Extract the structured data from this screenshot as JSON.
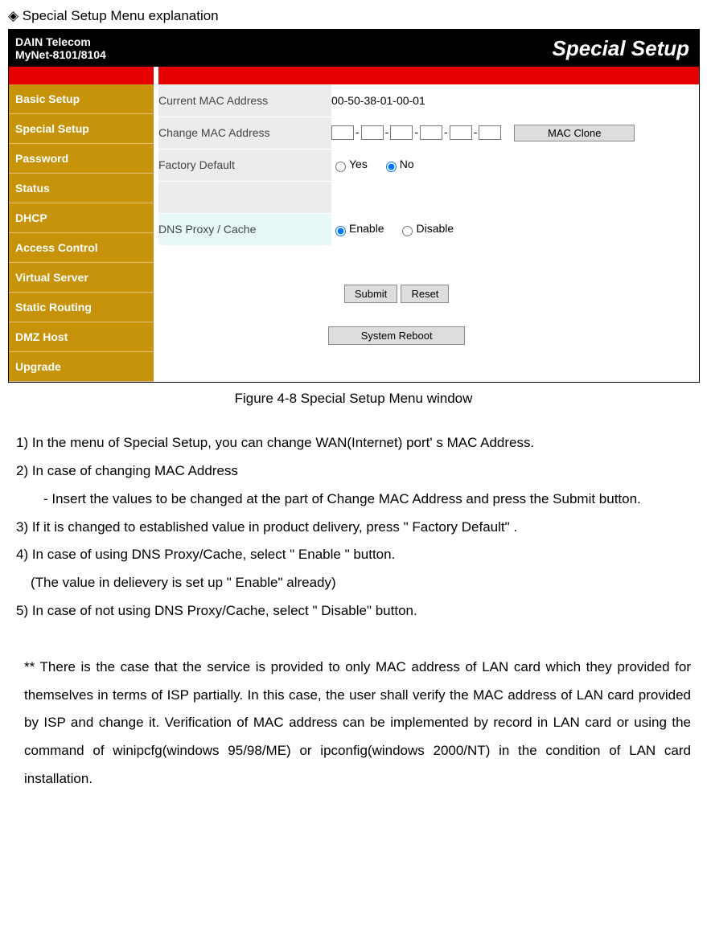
{
  "doc": {
    "heading": "◈  Special Setup Menu explanation",
    "caption": "Figure 4-8    Special Setup Menu window",
    "body": {
      "l1": "1) In the menu of Special Setup, you can change WAN(Internet) port' s MAC Address.",
      "l2": "2) In case of changing MAC Address",
      "l3": "- Insert the values to be changed at the part of Change MAC Address and press the Submit button.",
      "l4": "3) If it is changed to established value in product delivery, press \" Factory Default\" .",
      "l5": "4) In case of using DNS Proxy/Cache, select \" Enable \" button.",
      "l6": "(The value in delievery is set up \" Enable\" already)",
      "l7": "5) In case of not using DNS Proxy/Cache, select \" Disable\" button.",
      "note": "** There is the case that the service is provided to only MAC address of LAN card which they provided for themselves in terms of ISP partially. In this case, the user shall verify the MAC address of LAN card provided by ISP and change it.  Verification of MAC address can be implemented by record in LAN card or using the command of winipcfg(windows 95/98/ME) or ipconfig(windows 2000/NT) in the condition of LAN card installation."
    }
  },
  "ui": {
    "brand_line1": "DAIN Telecom",
    "brand_line2": "MyNet-8101/8104",
    "page_title": "Special Setup",
    "sidebar": [
      "Basic Setup",
      "Special Setup",
      "Password",
      "Status",
      "DHCP",
      "Access Control",
      "Virtual Server",
      "Static Routing",
      "DMZ Host",
      "Upgrade"
    ],
    "rows": {
      "current_mac_label": "Current MAC Address",
      "current_mac_value": "00-50-38-01-00-01",
      "change_mac_label": "Change MAC Address",
      "mac_clone_btn": "MAC Clone",
      "factory_label": "Factory Default",
      "factory_yes": "Yes",
      "factory_no": "No",
      "dns_label": "DNS Proxy / Cache",
      "dns_enable": "Enable",
      "dns_disable": "Disable"
    },
    "buttons": {
      "submit": "Submit",
      "reset": "Reset",
      "reboot": "System Reboot"
    }
  }
}
